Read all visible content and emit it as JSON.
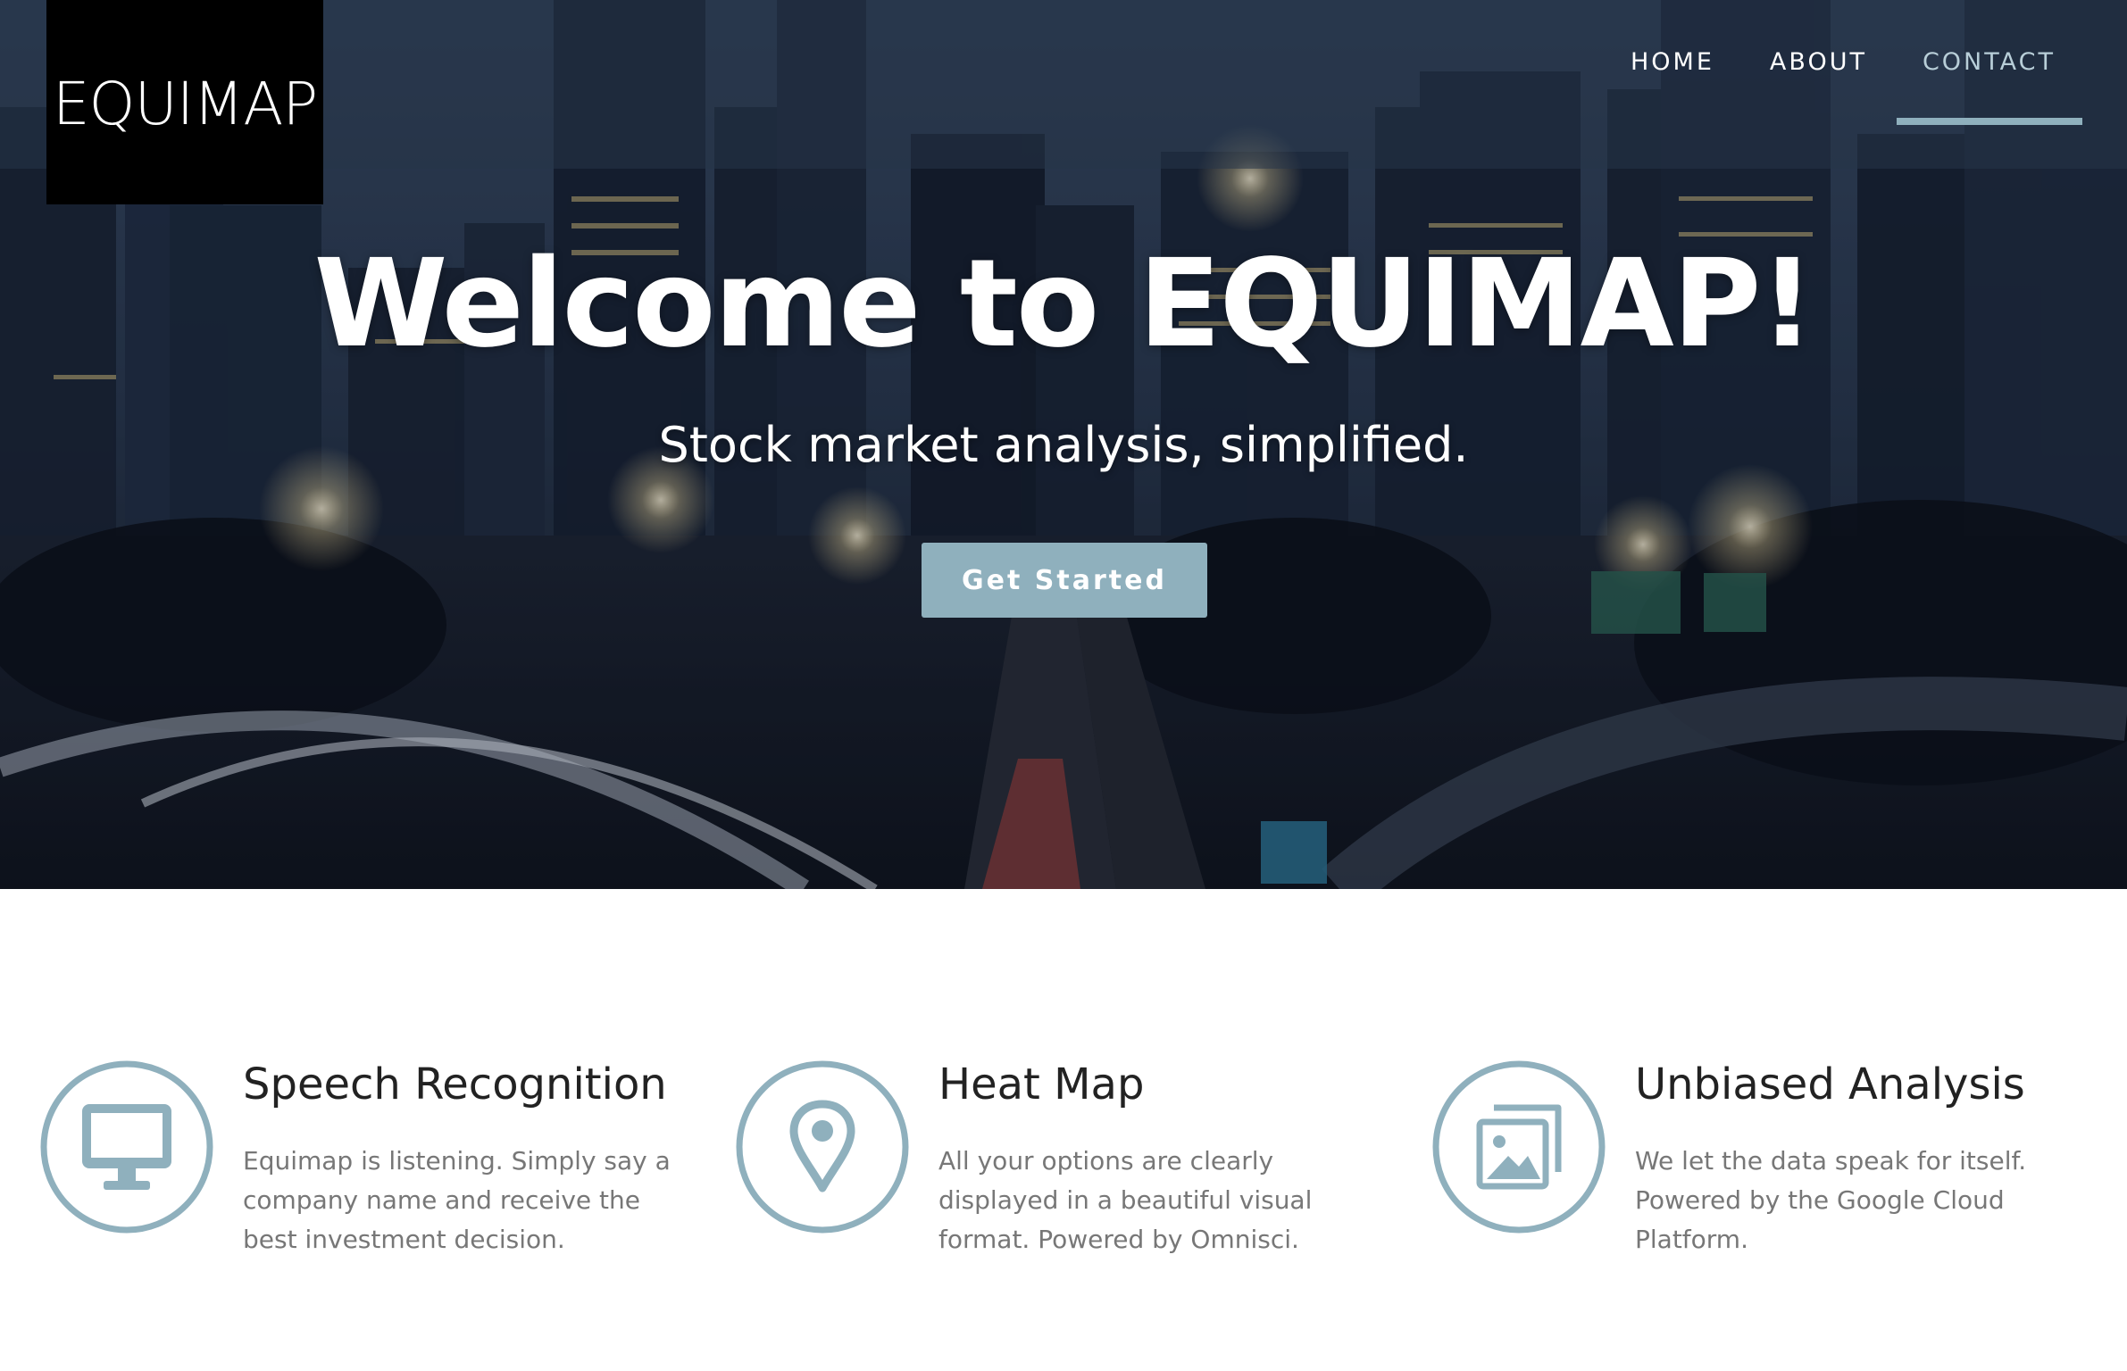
{
  "brand": {
    "logo_text": "EQUIMAP"
  },
  "nav": {
    "items": [
      {
        "label": "HOME",
        "active": false
      },
      {
        "label": "ABOUT",
        "active": false
      },
      {
        "label": "CONTACT",
        "active": true
      }
    ]
  },
  "hero": {
    "title": "Welcome to EQUIMAP!",
    "subtitle": "Stock market analysis, simplified.",
    "cta_label": "Get Started",
    "background_icon": "city-highway-night-photo"
  },
  "features": [
    {
      "icon": "monitor-icon",
      "title": "Speech Recognition",
      "description": "Equimap is listening. Simply say a company name and receive the best investment decision."
    },
    {
      "icon": "map-pin-icon",
      "title": "Heat Map",
      "description": "All your options are clearly displayed in a beautiful visual format. Powered by Omnisci."
    },
    {
      "icon": "images-icon",
      "title": "Unbiased Analysis",
      "description": "We let the data speak for itself. Powered by the Google Cloud Platform."
    }
  ],
  "colors": {
    "accent": "#8fb0bd",
    "logo_bg": "#000000",
    "text_dark": "#222222",
    "text_muted": "#777777"
  }
}
